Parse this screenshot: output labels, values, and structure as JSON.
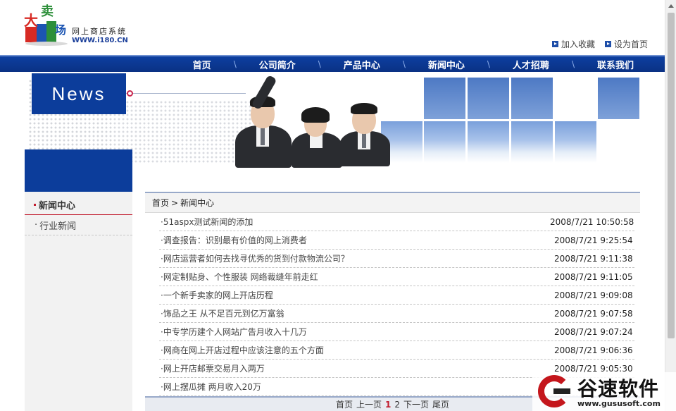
{
  "logo": {
    "mark_text": "大卖场",
    "name": "网上商店系统",
    "url": "WWW.i180.CN"
  },
  "toplinks": [
    {
      "label": "加入收藏"
    },
    {
      "label": "设为首页"
    }
  ],
  "nav": [
    {
      "label": "首页"
    },
    {
      "label": "公司简介"
    },
    {
      "label": "产品中心"
    },
    {
      "label": "新闻中心"
    },
    {
      "label": "人才招聘"
    },
    {
      "label": "联系我们"
    }
  ],
  "nav_separator": "\\",
  "banner": {
    "badge": "News"
  },
  "sidebar": {
    "items": [
      {
        "label": "新闻中心",
        "active": true
      },
      {
        "label": "行业新闻",
        "active": false
      }
    ]
  },
  "breadcrumb": {
    "home": "首页",
    "sep": ">",
    "current": "新闻中心"
  },
  "news": [
    {
      "title": "51aspx测试新闻的添加",
      "date": "2008/7/21 10:50:58"
    },
    {
      "title": "调查报告：识别最有价值的网上消费者",
      "date": "2008/7/21 9:25:54"
    },
    {
      "title": "网店运营者如何去找寻优秀的货到付款物流公司？",
      "date": "2008/7/21 9:11:38"
    },
    {
      "title": "网定制贴身、个性服装 网络裁缝年前走红",
      "date": "2008/7/21 9:11:05"
    },
    {
      "title": "一个新手卖家的网上开店历程",
      "date": "2008/7/21 9:09:08"
    },
    {
      "title": "饰品之王 从不足百元到亿万富翁",
      "date": "2008/7/21 9:07:58"
    },
    {
      "title": "中专学历建个人网站广告月收入十几万",
      "date": "2008/7/21 9:07:24"
    },
    {
      "title": "网商在网上开店过程中应该注意的五个方面",
      "date": "2008/7/21 9:06:36"
    },
    {
      "title": "网上开店邮票交易月入两万",
      "date": "2008/7/21 9:05:30"
    },
    {
      "title": "网上摆瓜摊 两月收入20万",
      "date": ""
    }
  ],
  "pager": {
    "first": "首页",
    "prev": "上一页",
    "pages": [
      "1",
      "2"
    ],
    "current_page": "1",
    "next": "下一页",
    "last": "尾页"
  },
  "watermark": {
    "cn": "谷速软件",
    "en": "www.gususoft.com"
  },
  "colors": {
    "nav_blue": "#0c3d9b",
    "accent_red": "#c21d2f"
  }
}
